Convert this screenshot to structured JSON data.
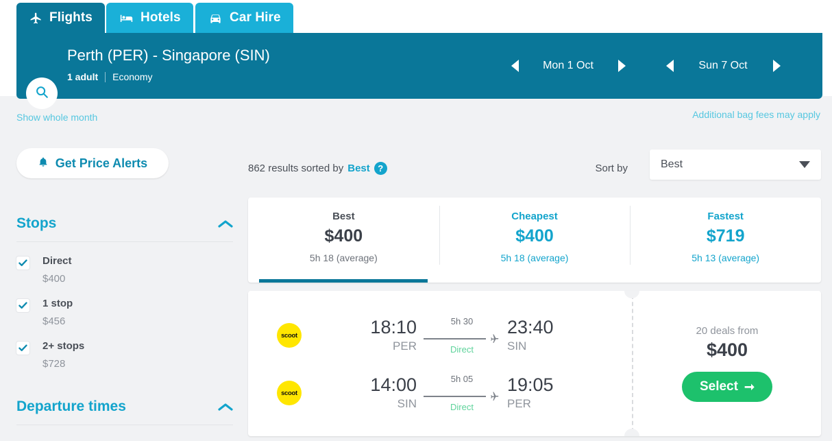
{
  "tabs": [
    {
      "label": "Flights",
      "icon": "plane-icon",
      "active": true
    },
    {
      "label": "Hotels",
      "icon": "bed-icon",
      "active": false
    },
    {
      "label": "Car Hire",
      "icon": "car-icon",
      "active": false
    }
  ],
  "search_header": {
    "search_icon": "magnifier-icon",
    "route": "Perth (PER) - Singapore (SIN)",
    "passengers": "1 adult",
    "separator": "|",
    "cabin": "Economy",
    "outbound": {
      "prev_icon": "chevron-left-icon",
      "date": "Mon 1 Oct",
      "next_icon": "chevron-right-icon"
    },
    "inbound": {
      "prev_icon": "chevron-left-icon",
      "date": "Sun 7 Oct",
      "next_icon": "chevron-right-icon"
    }
  },
  "links": {
    "show_whole_month": "Show whole month",
    "bag_fees": "Additional bag fees may apply"
  },
  "sidebar": {
    "price_alerts": {
      "label": "Get Price Alerts",
      "icon": "bell-icon"
    },
    "filters": [
      {
        "title": "Stops",
        "collapse_icon": "chevron-up-icon",
        "options": [
          {
            "label": "Direct",
            "price": "$400",
            "checked": true
          },
          {
            "label": "1 stop",
            "price": "$456",
            "checked": true
          },
          {
            "label": "2+ stops",
            "price": "$728",
            "checked": true
          }
        ]
      },
      {
        "title": "Departure times",
        "collapse_icon": "chevron-up-icon",
        "options": []
      }
    ]
  },
  "results_bar": {
    "count_prefix": "862 results sorted by",
    "count_sort": "Best",
    "help_icon": "question-mark-icon",
    "sort_by_label": "Sort by",
    "sort_value": "Best",
    "sort_caret": "chevron-down-icon"
  },
  "summary_tabs": [
    {
      "label": "Best",
      "price": "$400",
      "average": "5h 18 (average)",
      "active": true
    },
    {
      "label": "Cheapest",
      "price": "$400",
      "average": "5h 18 (average)",
      "active": false
    },
    {
      "label": "Fastest",
      "price": "$719",
      "average": "5h 13 (average)",
      "active": false
    }
  ],
  "flight_card": {
    "legs": [
      {
        "airline": "scoot",
        "depart_time": "18:10",
        "depart_code": "PER",
        "duration": "5h 30",
        "stops": "Direct",
        "plane_icon": "plane-right-icon",
        "arrive_time": "23:40",
        "arrive_code": "SIN"
      },
      {
        "airline": "scoot",
        "depart_time": "14:00",
        "depart_code": "SIN",
        "duration": "5h 05",
        "stops": "Direct",
        "plane_icon": "plane-right-icon",
        "arrive_time": "19:05",
        "arrive_code": "PER"
      }
    ],
    "deals_count": "20 deals from",
    "deals_price": "$400",
    "select_label": "Select",
    "select_arrow": "arrow-right-icon"
  },
  "colors": {
    "header_teal": "#0a7799",
    "tab_inactive": "#1ab0d8",
    "accent_cyan": "#13a4cc",
    "link_cyan": "#56c7e0",
    "select_green": "#1dc16c",
    "direct_green": "#5ed39b",
    "airline_yellow": "#ffe600",
    "page_bg": "#f1f2f4",
    "text_dark": "#3b4049",
    "text_muted": "#8f949c"
  }
}
